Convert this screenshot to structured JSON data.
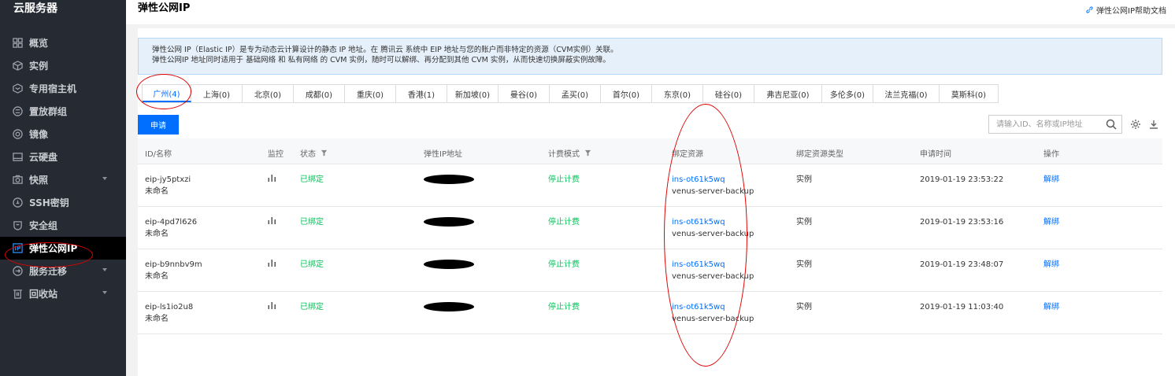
{
  "sidebar": {
    "title": "云服务器",
    "items": [
      {
        "label": "概览",
        "icon": "overview-grid-icon"
      },
      {
        "label": "实例",
        "icon": "instance-cube-icon"
      },
      {
        "label": "专用宿主机",
        "icon": "dedicated-host-icon"
      },
      {
        "label": "置放群组",
        "icon": "placement-group-icon"
      },
      {
        "label": "镜像",
        "icon": "image-disc-icon"
      },
      {
        "label": "云硬盘",
        "icon": "cloud-disk-icon"
      },
      {
        "label": "快照",
        "icon": "snapshot-camera-icon"
      },
      {
        "label": "SSH密钥",
        "icon": "ssh-key-icon"
      },
      {
        "label": "安全组",
        "icon": "security-shield-icon"
      },
      {
        "label": "弹性公网IP",
        "icon": "eip-icon"
      },
      {
        "label": "服务迁移",
        "icon": "migration-icon"
      },
      {
        "label": "回收站",
        "icon": "recycle-bin-icon"
      }
    ]
  },
  "header": {
    "title": "弹性公网IP",
    "help_link": "弹性公网IP帮助文档"
  },
  "notice": {
    "line1": "弹性公网 IP（Elastic IP）是专为动态云计算设计的静态 IP 地址。在 腾讯云 系统中 EIP 地址与您的账户而非特定的资源（CVM实例）关联。",
    "line2": "弹性公网IP 地址同时适用于 基础网络 和 私有网络 的 CVM 实例，随时可以解绑、再分配到其他 CVM 实例，从而快速切换屏蔽实例故障。"
  },
  "regions": [
    {
      "label": "广州(4)",
      "active": true
    },
    {
      "label": "上海(0)"
    },
    {
      "label": "北京(0)"
    },
    {
      "label": "成都(0)"
    },
    {
      "label": "重庆(0)"
    },
    {
      "label": "香港(1)"
    },
    {
      "label": "新加坡(0)"
    },
    {
      "label": "曼谷(0)"
    },
    {
      "label": "孟买(0)"
    },
    {
      "label": "首尔(0)"
    },
    {
      "label": "东京(0)"
    },
    {
      "label": "硅谷(0)"
    },
    {
      "label": "弗吉尼亚(0)"
    },
    {
      "label": "多伦多(0)"
    },
    {
      "label": "法兰克福(0)"
    },
    {
      "label": "莫斯科(0)"
    }
  ],
  "toolbar": {
    "apply_label": "申请",
    "search_placeholder": "请输入ID、名称或IP地址"
  },
  "table": {
    "headers": {
      "id_name": "ID/名称",
      "monitor": "监控",
      "status": "状态",
      "ip": "弹性IP地址",
      "billing": "计费模式",
      "bound_resource": "绑定资源",
      "resource_type": "绑定资源类型",
      "apply_time": "申请时间",
      "actions": "操作"
    },
    "rows": [
      {
        "id": "eip-jy5ptxzi",
        "name": "未命名",
        "status": "已绑定",
        "billing": "停止计费",
        "resource_id": "ins-ot61k5wq",
        "resource_name": "venus-server-backup",
        "resource_type": "实例",
        "apply_time": "2019-01-19 23:53:22",
        "action": "解绑"
      },
      {
        "id": "eip-4pd7l626",
        "name": "未命名",
        "status": "已绑定",
        "billing": "停止计费",
        "resource_id": "ins-ot61k5wq",
        "resource_name": "venus-server-backup",
        "resource_type": "实例",
        "apply_time": "2019-01-19 23:53:16",
        "action": "解绑"
      },
      {
        "id": "eip-b9nnbv9m",
        "name": "未命名",
        "status": "已绑定",
        "billing": "停止计费",
        "resource_id": "ins-ot61k5wq",
        "resource_name": "venus-server-backup",
        "resource_type": "实例",
        "apply_time": "2019-01-19 23:48:07",
        "action": "解绑"
      },
      {
        "id": "eip-ls1io2u8",
        "name": "未命名",
        "status": "已绑定",
        "billing": "停止计费",
        "resource_id": "ins-ot61k5wq",
        "resource_name": "venus-server-backup",
        "resource_type": "实例",
        "apply_time": "2019-01-19 11:03:40",
        "action": "解绑"
      }
    ]
  },
  "colors": {
    "accent": "#006eff",
    "success": "#0abf5b",
    "annotation": "#e00000",
    "sidebar_bg": "#262b33"
  }
}
